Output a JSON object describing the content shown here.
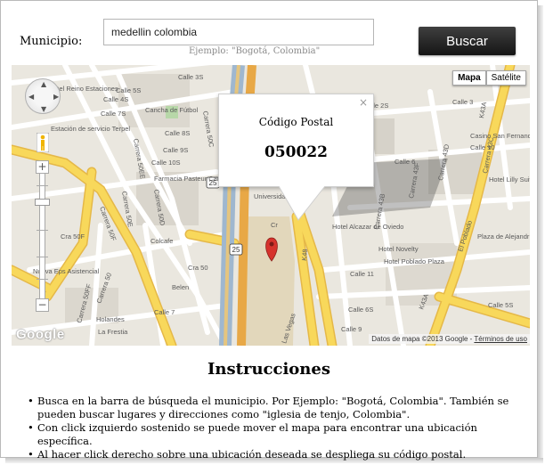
{
  "form": {
    "label": "Municipio:",
    "input_value": "medellin colombia",
    "hint": "Ejemplo: \"Bogotá, Colombia\"",
    "button_label": "Buscar"
  },
  "map": {
    "maptype_map": "Mapa",
    "maptype_satellite": "Satélite",
    "google_logo": "Google",
    "attribution": "Datos de mapa ©2013 Google - ",
    "terms_link": "Términos de uso",
    "street_labels": [
      "Calle 3S",
      "Calle 4S",
      "Calle 5S",
      "Calle 7S",
      "Calle 8S",
      "Calle 9S",
      "Calle 10S",
      "Calle 2S",
      "Calle 3",
      "Calle 6",
      "Calle 7",
      "Calle 9",
      "Calle 6S",
      "Calle 5S",
      "Carrera 50FF",
      "Carrera 50F",
      "Carrera 50EE",
      "Carrera 50E",
      "Carrera 50C",
      "Carrera 50D",
      "Carrera 50",
      "Carrera 43B",
      "Carrera 43F",
      "Carrera 43D",
      "Carrera 43C",
      "K48",
      "K43A",
      "K43A",
      "Las Vegas",
      "El Poblado",
      "Calle 10",
      "Calle 11"
    ],
    "place_labels": [
      "Del Reino Estaciones",
      "Estación de servicio Terpel",
      "Cancha de Fútbol",
      "Farmacia Pasteur Carrefour Apolo",
      "Colcafe",
      "Universidad Eafit",
      "Hotel Alcazar de Oviedo",
      "Hotel Novelty",
      "Hotel Poblado Plaza",
      "Plaza de Alejandría",
      "Casino San Fernando",
      "Hotel Lilly Suites",
      "Nueva Eps Asistencial",
      "La Frestia",
      "Holandes",
      "Cra 50F",
      "Cra 50",
      "Belen",
      "Cr"
    ],
    "route_shields": [
      "25",
      "25"
    ]
  },
  "popup": {
    "close": "×",
    "title": "Código Postal",
    "code": "050022"
  },
  "instructions": {
    "title": "Instrucciones",
    "items": [
      "Busca en la barra de búsqueda el municipio. Por Ejemplo: \"Bogotá, Colombia\". También se pueden buscar lugares y direcciones como \"iglesia de tenjo, Colombia\".",
      "Con click izquierdo sostenido se puede mover el mapa para encontrar una ubicación específica.",
      "Al hacer click derecho sobre una ubicación deseada se despliega su código postal."
    ]
  },
  "colors": {
    "major_road": "#f8d85b",
    "minor_road": "#ffffff",
    "highway": "#e8a846",
    "campus": "#e2d7bb",
    "map_bg": "#eae7df",
    "marker": "#d6332c",
    "button_bg": "#1f1f1f"
  }
}
